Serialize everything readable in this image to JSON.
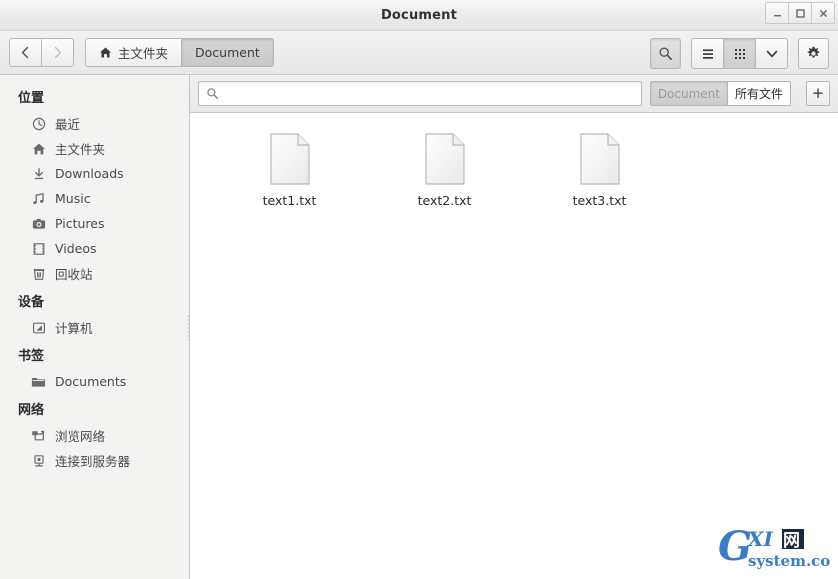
{
  "window": {
    "title": "Document",
    "controls": [
      {
        "name": "minimize",
        "glyph": "–"
      },
      {
        "name": "maximize",
        "glyph": "□"
      },
      {
        "name": "close",
        "glyph": "✕"
      }
    ]
  },
  "toolbar": {
    "back_label": "‹",
    "forward_label": "›",
    "breadcrumbs": [
      {
        "label": "主文件夹",
        "icon": "home-icon",
        "active": false
      },
      {
        "label": "Document",
        "icon": "",
        "active": true
      }
    ],
    "search_button": "search-icon",
    "view_list": "list-view-icon",
    "view_grid": "grid-view-icon",
    "view_dropdown": "chevron-down-icon",
    "settings": "gear-icon"
  },
  "search": {
    "value": "",
    "placeholder": "",
    "icon": "search-icon"
  },
  "tabs": {
    "items": [
      {
        "label": "Document",
        "active": false
      },
      {
        "label": "所有文件",
        "active": true
      }
    ],
    "add_label": "+"
  },
  "sidebar": {
    "sections": [
      {
        "title": "位置",
        "items": [
          {
            "label": "最近",
            "icon": "clock-icon"
          },
          {
            "label": "主文件夹",
            "icon": "home-icon"
          },
          {
            "label": "Downloads",
            "icon": "download-icon"
          },
          {
            "label": "Music",
            "icon": "music-icon"
          },
          {
            "label": "Pictures",
            "icon": "camera-icon"
          },
          {
            "label": "Videos",
            "icon": "film-icon"
          },
          {
            "label": "回收站",
            "icon": "trash-icon"
          }
        ]
      },
      {
        "title": "设备",
        "items": [
          {
            "label": "计算机",
            "icon": "computer-icon"
          }
        ]
      },
      {
        "title": "书签",
        "items": [
          {
            "label": "Documents",
            "icon": "folder-icon"
          }
        ]
      },
      {
        "title": "网络",
        "items": [
          {
            "label": "浏览网络",
            "icon": "network-icon"
          },
          {
            "label": "连接到服务器",
            "icon": "server-icon"
          }
        ]
      }
    ]
  },
  "files": [
    {
      "name": "text1.txt",
      "icon": "text-file-icon"
    },
    {
      "name": "text2.txt",
      "icon": "text-file-icon"
    },
    {
      "name": "text3.txt",
      "icon": "text-file-icon"
    }
  ],
  "watermark": {
    "primary": "G",
    "secondary": "XI",
    "cjk": "网",
    "domain": "system.com",
    "color": "#3b7cc4"
  },
  "colors": {
    "sidebar_bg": "#f3f3f2",
    "content_bg": "#ffffff",
    "toolbar_bg": "#ececec",
    "border": "#c4c4c4",
    "text": "#2e3436"
  }
}
